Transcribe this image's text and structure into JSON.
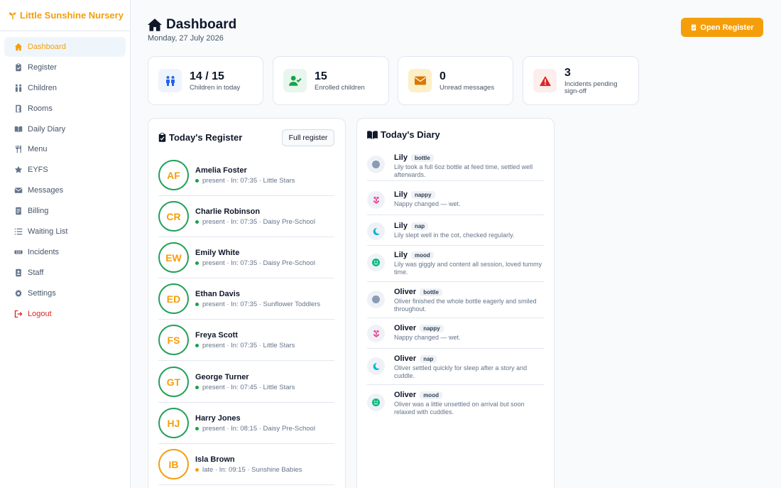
{
  "brand": {
    "name": "Little Sunshine Nursery"
  },
  "sidebar": {
    "items": [
      {
        "label": "Dashboard",
        "icon": "home-icon",
        "active": true
      },
      {
        "label": "Register",
        "icon": "clipboard-icon"
      },
      {
        "label": "Children",
        "icon": "children-icon"
      },
      {
        "label": "Rooms",
        "icon": "door-icon"
      },
      {
        "label": "Daily Diary",
        "icon": "book-icon"
      },
      {
        "label": "Menu",
        "icon": "utensils-icon"
      },
      {
        "label": "EYFS",
        "icon": "star-icon"
      },
      {
        "label": "Messages",
        "icon": "envelope-icon"
      },
      {
        "label": "Billing",
        "icon": "receipt-icon"
      },
      {
        "label": "Waiting List",
        "icon": "list-icon"
      },
      {
        "label": "Incidents",
        "icon": "bandage-icon"
      },
      {
        "label": "Staff",
        "icon": "id-badge-icon"
      },
      {
        "label": "Settings",
        "icon": "gear-icon"
      },
      {
        "label": "Logout",
        "icon": "logout-icon"
      }
    ]
  },
  "header": {
    "title": "Dashboard",
    "date": "Monday, 27 July 2026",
    "open_register_label": "Open Register"
  },
  "stats": [
    {
      "value": "14 / 15",
      "label": "Children in today",
      "icon": "children-icon",
      "color": "#2563eb",
      "bg": "#eef4fb"
    },
    {
      "value": "15",
      "label": "Enrolled children",
      "icon": "user-check-icon",
      "color": "#16a34a",
      "bg": "#e8f6ee"
    },
    {
      "value": "0",
      "label": "Unread messages",
      "icon": "envelope-icon",
      "color": "#d97706",
      "bg": "#fdf0c8"
    },
    {
      "value": "3",
      "label": "Incidents pending sign-off",
      "icon": "warning-icon",
      "color": "#dc2626",
      "bg": "#fdeeee"
    }
  ],
  "register": {
    "title": "Today's Register",
    "full_register_label": "Full register",
    "rows": [
      {
        "initials": "AF",
        "name": "Amelia Foster",
        "status": "present",
        "meta": "present · In: 07:35 · Little Stars"
      },
      {
        "initials": "CR",
        "name": "Charlie Robinson",
        "status": "present",
        "meta": "present · In: 07:35 · Daisy Pre-School"
      },
      {
        "initials": "EW",
        "name": "Emily White",
        "status": "present",
        "meta": "present · In: 07:35 · Daisy Pre-School"
      },
      {
        "initials": "ED",
        "name": "Ethan Davis",
        "status": "present",
        "meta": "present · In: 07:35 · Sunflower Toddlers"
      },
      {
        "initials": "FS",
        "name": "Freya Scott",
        "status": "present",
        "meta": "present · In: 07:35 · Little Stars"
      },
      {
        "initials": "GT",
        "name": "George Turner",
        "status": "present",
        "meta": "present · In: 07:45 · Little Stars"
      },
      {
        "initials": "HJ",
        "name": "Harry Jones",
        "status": "present",
        "meta": "present · In: 08:15 · Daisy Pre-School"
      },
      {
        "initials": "IB",
        "name": "Isla Brown",
        "status": "late",
        "meta": "late · In: 09:15 · Sunshine Babies"
      }
    ]
  },
  "diary": {
    "title": "Today's Diary",
    "rows": [
      {
        "name": "Lily",
        "badge": "bottle",
        "icon": "bottle-icon",
        "text": "Lily took a full 6oz bottle at feed time, settled well afterwards."
      },
      {
        "name": "Lily",
        "badge": "nappy",
        "icon": "nappy-icon",
        "text": "Nappy changed — wet."
      },
      {
        "name": "Lily",
        "badge": "nap",
        "icon": "moon-icon",
        "text": "Lily slept well in the cot, checked regularly."
      },
      {
        "name": "Lily",
        "badge": "mood",
        "icon": "smile-icon",
        "text": "Lily was giggly and content all session, loved tummy time."
      },
      {
        "name": "Oliver",
        "badge": "bottle",
        "icon": "bottle-icon",
        "text": "Oliver finished the whole bottle eagerly and smiled throughout."
      },
      {
        "name": "Oliver",
        "badge": "nappy",
        "icon": "nappy-icon",
        "text": "Nappy changed — wet."
      },
      {
        "name": "Oliver",
        "badge": "nap",
        "icon": "moon-icon",
        "text": "Oliver settled quickly for sleep after a story and cuddle."
      },
      {
        "name": "Oliver",
        "badge": "mood",
        "icon": "smile-icon",
        "text": "Oliver was a little unsettled on arrival but soon relaxed with cuddles."
      }
    ]
  },
  "colors": {
    "accent": "#f59e0b",
    "present": "#16a34a",
    "late": "#f59e0b",
    "danger": "#dc2626"
  }
}
